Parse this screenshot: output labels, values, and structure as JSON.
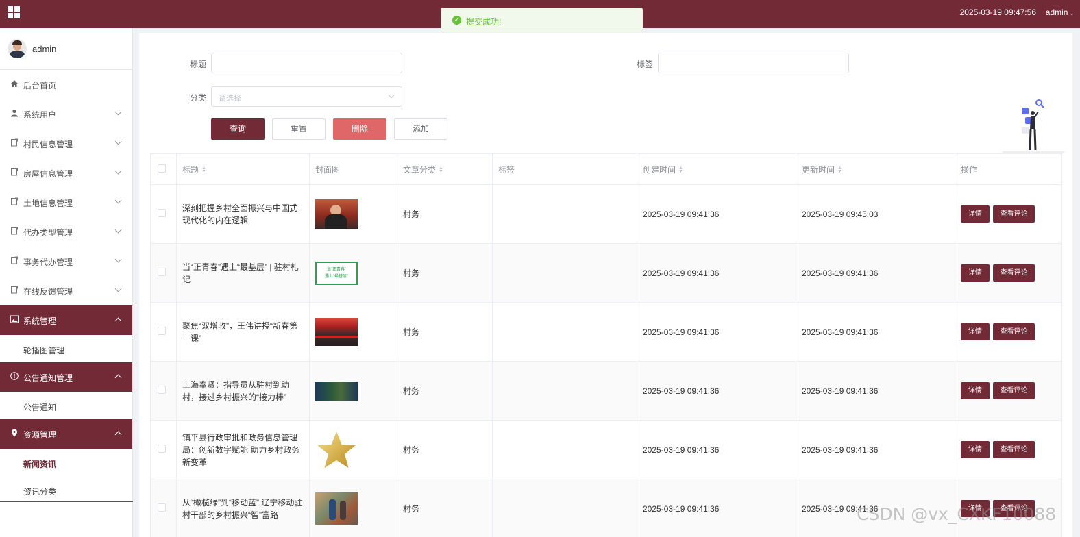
{
  "topbar": {
    "datetime": "2025-03-19 09:47:56",
    "user": "admin"
  },
  "toast": {
    "message": "提交成功!"
  },
  "sidebar": {
    "username": "admin",
    "menu": [
      {
        "label": "后台首页",
        "icon": "home-icon"
      },
      {
        "label": "系统用户",
        "icon": "user-icon"
      },
      {
        "label": "村民信息管理",
        "icon": "doc-icon"
      },
      {
        "label": "房屋信息管理",
        "icon": "doc-icon"
      },
      {
        "label": "土地信息管理",
        "icon": "doc-icon"
      },
      {
        "label": "代办类型管理",
        "icon": "doc-icon"
      },
      {
        "label": "事务代办管理",
        "icon": "doc-icon"
      },
      {
        "label": "在线反馈管理",
        "icon": "doc-icon"
      },
      {
        "label": "系统管理",
        "icon": "image-icon",
        "sub": [
          "轮播图管理"
        ]
      },
      {
        "label": "公告通知管理",
        "icon": "info-icon",
        "sub": [
          "公告通知"
        ]
      },
      {
        "label": "资源管理",
        "icon": "location-icon",
        "sub": [
          "新闻资讯",
          "资讯分类"
        ]
      }
    ]
  },
  "filters": {
    "title_label": "标题",
    "tag_label": "标签",
    "category_label": "分类",
    "category_placeholder": "请选择",
    "buttons": {
      "query": "查询",
      "reset": "重置",
      "delete": "删除",
      "add": "添加"
    }
  },
  "table": {
    "headers": [
      "标题",
      "封面图",
      "文章分类",
      "标签",
      "创建时间",
      "更新时间",
      "操作"
    ],
    "action_detail": "详情",
    "action_comments": "查看评论",
    "rows": [
      {
        "title": "深刻把握乡村全面振兴与中国式现代化的内在逻辑",
        "category": "村务",
        "tag": "",
        "created": "2025-03-19 09:41:36",
        "updated": "2025-03-19 09:45:03"
      },
      {
        "title": "当“正青春”遇上“最基层” | 驻村札记",
        "category": "村务",
        "tag": "",
        "created": "2025-03-19 09:41:36",
        "updated": "2025-03-19 09:41:36",
        "thumb_text_1": "当“正青春”",
        "thumb_text_2": "遇上“最基层”"
      },
      {
        "title": "聚焦“双增收”，王伟讲授“新春第一课”",
        "category": "村务",
        "tag": "",
        "created": "2025-03-19 09:41:36",
        "updated": "2025-03-19 09:41:36"
      },
      {
        "title": "上海奉贤：指导员从驻村到助村，接过乡村振兴的“接力棒”",
        "category": "村务",
        "tag": "",
        "created": "2025-03-19 09:41:36",
        "updated": "2025-03-19 09:41:36"
      },
      {
        "title": "镇平县行政审批和政务信息管理局：创新数字赋能 助力乡村政务新变革",
        "category": "村务",
        "tag": "",
        "created": "2025-03-19 09:41:36",
        "updated": "2025-03-19 09:41:36"
      },
      {
        "title": "从“橄榄绿”到“移动蓝” 辽宁移动驻村干部的乡村振兴“智”富路",
        "category": "村务",
        "tag": "",
        "created": "2025-03-19 09:41:36",
        "updated": "2025-03-19 09:41:36"
      }
    ]
  },
  "watermark": "CSDN @vx_CXKF10088",
  "colors": {
    "brand": "#732a37",
    "danger": "#e06767",
    "success": "#67c23a"
  }
}
